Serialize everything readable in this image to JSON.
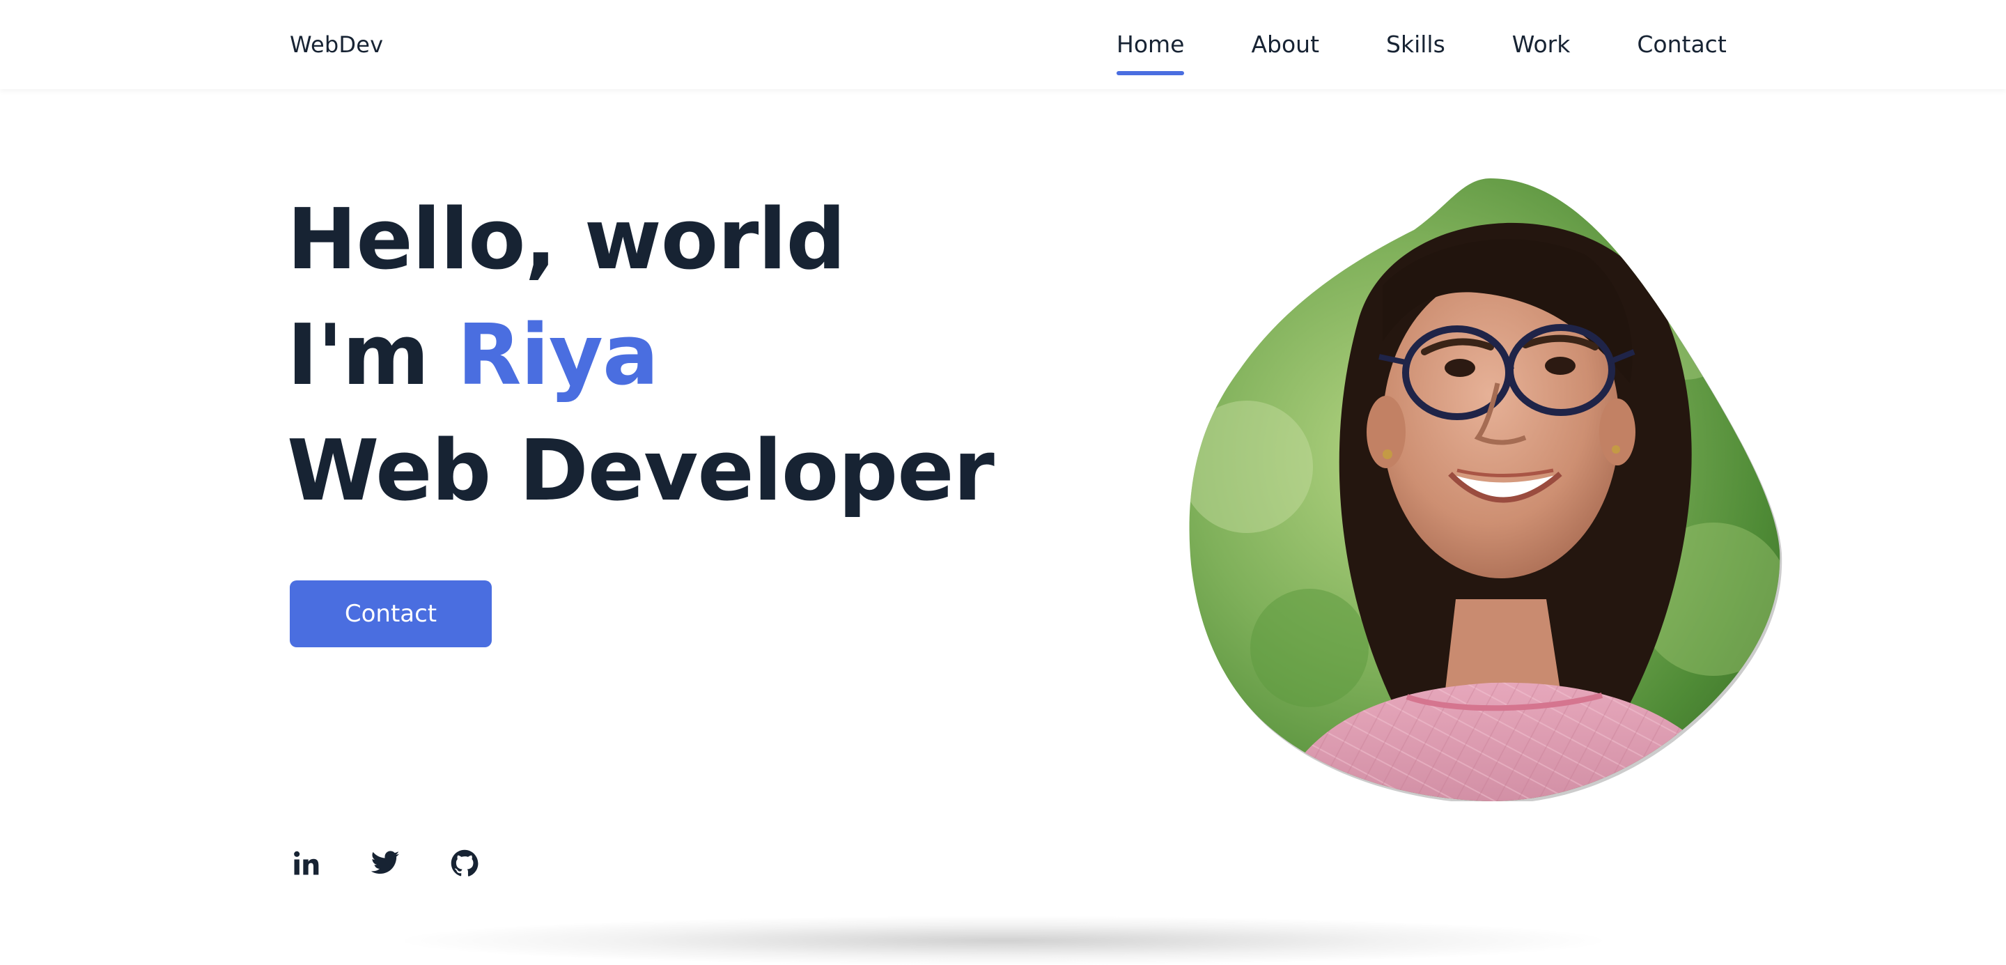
{
  "header": {
    "logo": "WebDev",
    "nav": [
      {
        "label": "Home",
        "active": true
      },
      {
        "label": "About",
        "active": false
      },
      {
        "label": "Skills",
        "active": false
      },
      {
        "label": "Work",
        "active": false
      },
      {
        "label": "Contact",
        "active": false
      }
    ]
  },
  "hero": {
    "greeting": "Hello, world",
    "intro_prefix": "I'm ",
    "name": "Riya",
    "role": "Web Developer",
    "contact_button": "Contact"
  },
  "social": [
    {
      "name": "linkedin",
      "icon": "linkedin-icon"
    },
    {
      "name": "twitter",
      "icon": "twitter-icon"
    },
    {
      "name": "github",
      "icon": "github-icon"
    }
  ],
  "colors": {
    "accent": "#4a6ee0",
    "text": "#172333",
    "background": "#ffffff"
  }
}
